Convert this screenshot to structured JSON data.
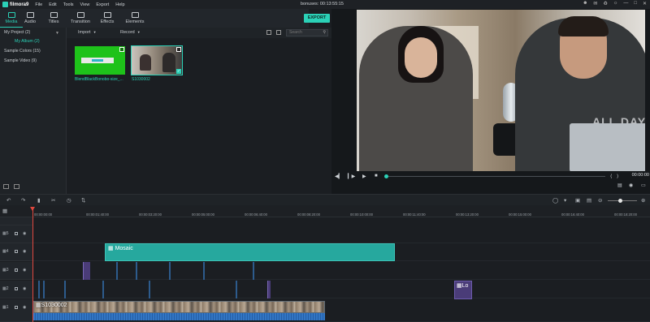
{
  "app": {
    "brand": "filmora9",
    "menu": [
      "File",
      "Edit",
      "Tools",
      "View",
      "Export",
      "Help"
    ],
    "window_title": "bonuses: 00:13:55:15"
  },
  "tabs": [
    {
      "label": "Media",
      "active": true
    },
    {
      "label": "Audio",
      "active": false
    },
    {
      "label": "Titles",
      "active": false
    },
    {
      "label": "Transition",
      "active": false
    },
    {
      "label": "Effects",
      "active": false
    },
    {
      "label": "Elements",
      "active": false
    }
  ],
  "export_label": "EXPORT",
  "sidebar": {
    "items": [
      {
        "label": "My Project (2)"
      },
      {
        "label": "My Album (2)"
      },
      {
        "label": "Sample Colors (15)"
      },
      {
        "label": "Sample Video (9)"
      }
    ]
  },
  "media_toolbar": {
    "import_label": "Import",
    "record_label": "Record",
    "search_placeholder": "Search"
  },
  "media": [
    {
      "name": "BlendBlackBonobo-size_..."
    },
    {
      "name": "S1030002"
    }
  ],
  "preview": {
    "shirt_text": "ALL DAY",
    "timecode": "00:00:00"
  },
  "ruler_ticks": [
    "00:00:00:00",
    "00:00:01:40:00",
    "00:00:03:20:00",
    "00:00:05:00:00",
    "00:00:06:40:00",
    "00:00:08:20:00",
    "00:00:10:00:00",
    "00:00:11:40:00",
    "00:00:13:20:00",
    "00:00:15:00:00",
    "00:00:16:40:00",
    "00:00:18:20:00"
  ],
  "tracks": [
    {
      "number": "5"
    },
    {
      "number": "4"
    },
    {
      "number": "3"
    },
    {
      "number": "2"
    },
    {
      "number": "1"
    }
  ],
  "clips": {
    "mosaic_label": "Mosaic",
    "lo_label": "Lo",
    "video_label": "S1030002"
  },
  "colors": {
    "accent": "#2bd1b7",
    "playhead": "#e0483e",
    "mosaic_clip": "#26a89e",
    "title_clip": "#4a3c78",
    "audio_wave": "#2a68b5"
  }
}
